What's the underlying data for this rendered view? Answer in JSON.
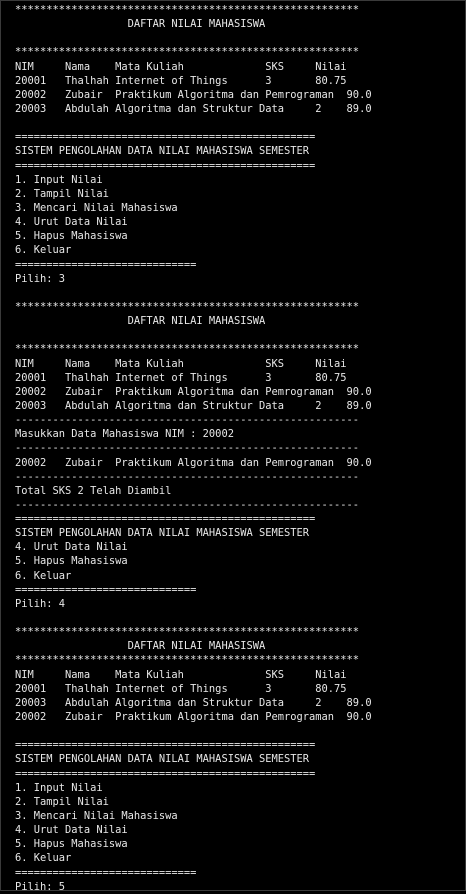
{
  "theme": {
    "background": "#000000",
    "foreground": "#e8e8e8"
  },
  "lines": [
    "*******************************************************",
    "                  DAFTAR NILAI MAHASISWA",
    "",
    "*******************************************************",
    "NIM     Nama    Mata Kuliah             SKS     Nilai",
    "20001   Thalhah Internet of Things      3       80.75",
    "20002   Zubair  Praktikum Algoritma dan Pemrograman  90.0",
    "20003   Abdulah Algoritma dan Struktur Data     2    89.0",
    "",
    "================================================",
    "SISTEM PENGOLAHAN DATA NILAI MAHASISWA SEMESTER",
    "================================================",
    "1. Input Nilai",
    "2. Tampil Nilai",
    "3. Mencari Nilai Mahasiswa",
    "4. Urut Data Nilai",
    "5. Hapus Mahasiswa",
    "6. Keluar",
    "=============================",
    "Pilih: 3",
    "",
    "*******************************************************",
    "                  DAFTAR NILAI MAHASISWA",
    "",
    "*******************************************************",
    "NIM     Nama    Mata Kuliah             SKS     Nilai",
    "20001   Thalhah Internet of Things      3       80.75",
    "20002   Zubair  Praktikum Algoritma dan Pemrograman  90.0",
    "20003   Abdulah Algoritma dan Struktur Data     2    89.0",
    "-------------------------------------------------------",
    "Masukkan Data Mahasiswa NIM : 20002",
    "-------------------------------------------------------",
    "20002   Zubair  Praktikum Algoritma dan Pemrograman  90.0",
    "-------------------------------------------------------",
    "Total SKS 2 Telah Diambil",
    "-------------------------------------------------------",
    "================================================",
    "SISTEM PENGOLAHAN DATA NILAI MAHASISWA SEMESTER",
    "4. Urut Data Nilai",
    "5. Hapus Mahasiswa",
    "6. Keluar",
    "=============================",
    "Pilih: 4",
    "",
    "*******************************************************",
    "                  DAFTAR NILAI MAHASISWA",
    "*******************************************************",
    "NIM     Nama    Mata Kuliah             SKS     Nilai",
    "20001   Thalhah Internet of Things      3       80.75",
    "20003   Abdulah Algoritma dan Struktur Data     2    89.0",
    "20002   Zubair  Praktikum Algoritma dan Pemrograman  90.0",
    "",
    "================================================",
    "SISTEM PENGOLAHAN DATA NILAI MAHASISWA SEMESTER",
    "================================================",
    "1. Input Nilai",
    "2. Tampil Nilai",
    "3. Mencari Nilai Mahasiswa",
    "4. Urut Data Nilai",
    "5. Hapus Mahasiswa",
    "6. Keluar",
    "=============================",
    "Pilih: 5"
  ]
}
